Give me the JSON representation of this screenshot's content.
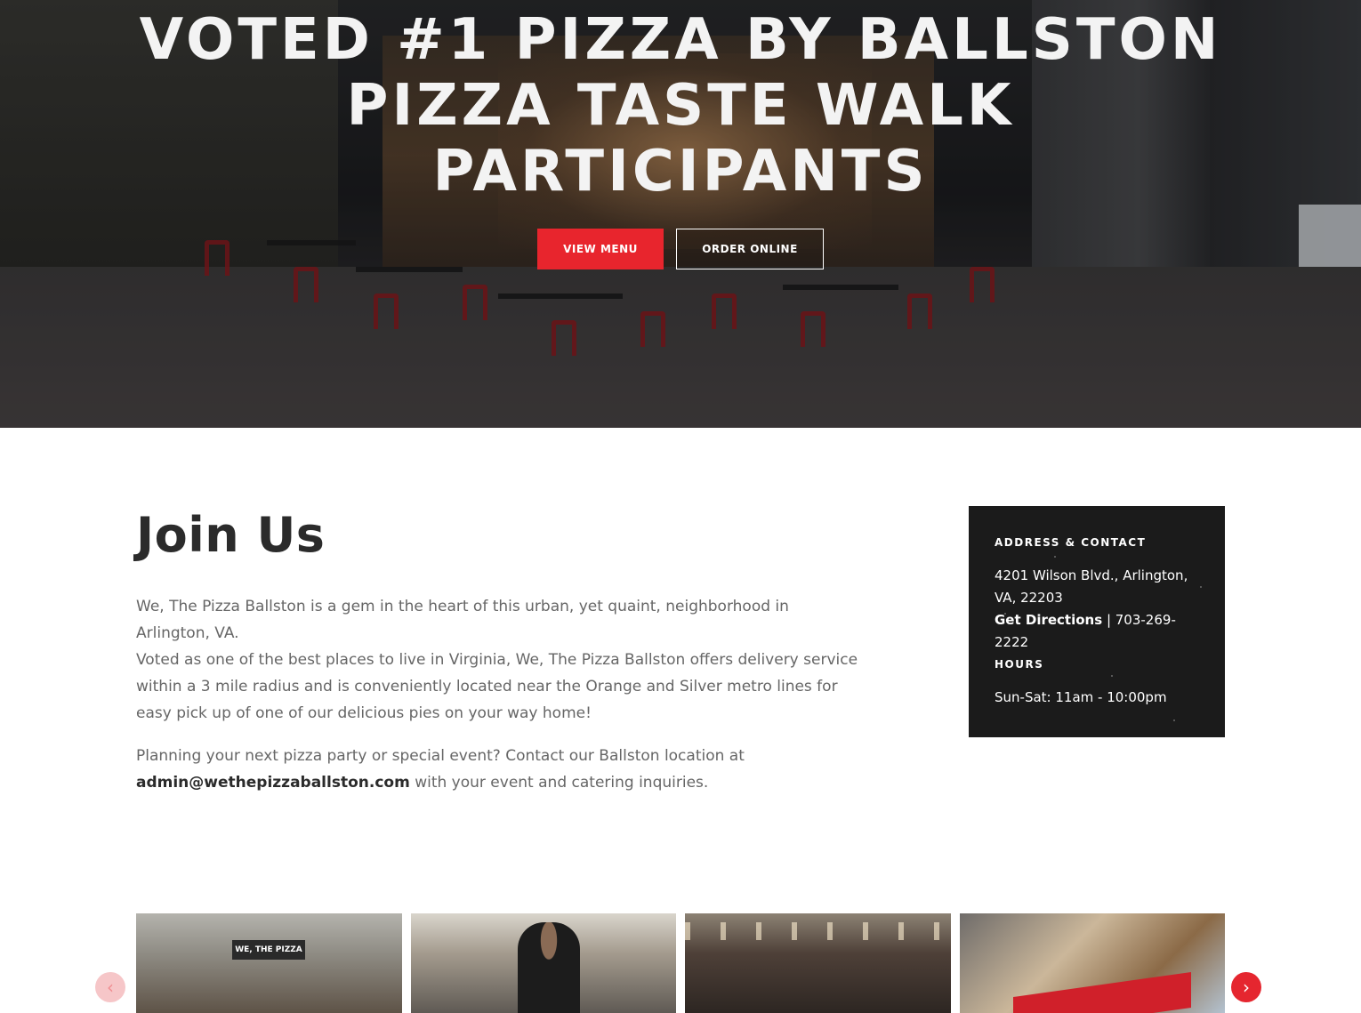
{
  "hero": {
    "title_lines": [
      "Voted #1 Pizza by Ballston",
      "Pizza Taste Walk",
      "Participants"
    ],
    "buttons": {
      "view_menu": "View Menu",
      "order_online": "Order Online"
    }
  },
  "join": {
    "title": "Join Us",
    "paragraph1": "We, The Pizza Ballston is a gem in the heart of this urban, yet quaint, neighborhood in Arlington, VA.",
    "paragraph2": "Voted as one of the best places to live in Virginia, We, The Pizza Ballston offers delivery service within a 3 mile radius and is conveniently located near the Orange and Silver metro lines for easy pick up of one of our delicious pies on your way home!",
    "paragraph3_before": "Planning your next pizza party or special event? Contact our Ballston location at ",
    "email": "admin@wethepizzaballston.com",
    "paragraph3_after": " with your event and catering inquiries."
  },
  "info": {
    "address_heading": "Address & Contact",
    "address": "4201 Wilson Blvd., Arlington, VA, 22203",
    "directions_label": "Get Directions",
    "separator": " | ",
    "phone": "703-269-2222",
    "hours_heading": "Hours",
    "hours": "Sun-Sat: 11am - 10:00pm"
  },
  "gallery": {
    "storefront_sign": "WE, THE PIZZA",
    "prev_icon": "‹",
    "next_icon": "›"
  },
  "colors": {
    "accent": "#e8252d",
    "info_box_bg": "#1b1b1b",
    "body_text": "#666666",
    "heading_text": "#2b2b2b"
  }
}
